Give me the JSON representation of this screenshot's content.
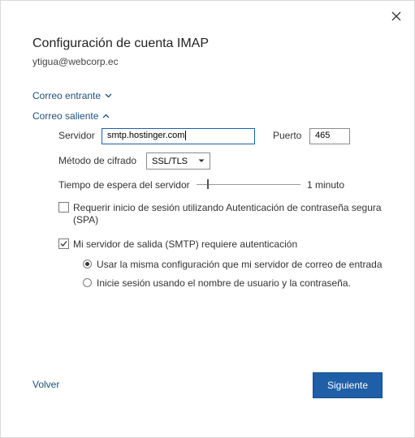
{
  "dialog": {
    "title": "Configuración de cuenta IMAP",
    "email": "ytigua@webcorp.ec"
  },
  "incoming": {
    "label": "Correo entrante"
  },
  "outgoing": {
    "label": "Correo saliente",
    "server_label": "Servidor",
    "server_value": "smtp.hostinger.com",
    "port_label": "Puerto",
    "port_value": "465",
    "encryption_label": "Método de cifrado",
    "encryption_value": "SSL/TLS",
    "timeout_label": "Tiempo de espera del servidor",
    "timeout_value": "1 minuto",
    "timeout_level": 0.1,
    "spa_label": "Requerir inicio de sesión utilizando Autenticación de contraseña segura",
    "spa_label_line2": "(SPA)",
    "spa_checked": false,
    "smtp_auth_label": "Mi servidor de salida (SMTP) requiere autenticación",
    "smtp_auth_checked": true,
    "radio_same_label": "Usar la misma configuración que mi servidor de correo de entrada",
    "radio_login_label": "Inicie sesión usando el nombre de usuario y la contraseña.",
    "selected_radio": "same"
  },
  "footer": {
    "back_label": "Volver",
    "next_label": "Siguiente"
  },
  "colors": {
    "accent": "#1f5fa8",
    "link": "#1f4e79"
  }
}
